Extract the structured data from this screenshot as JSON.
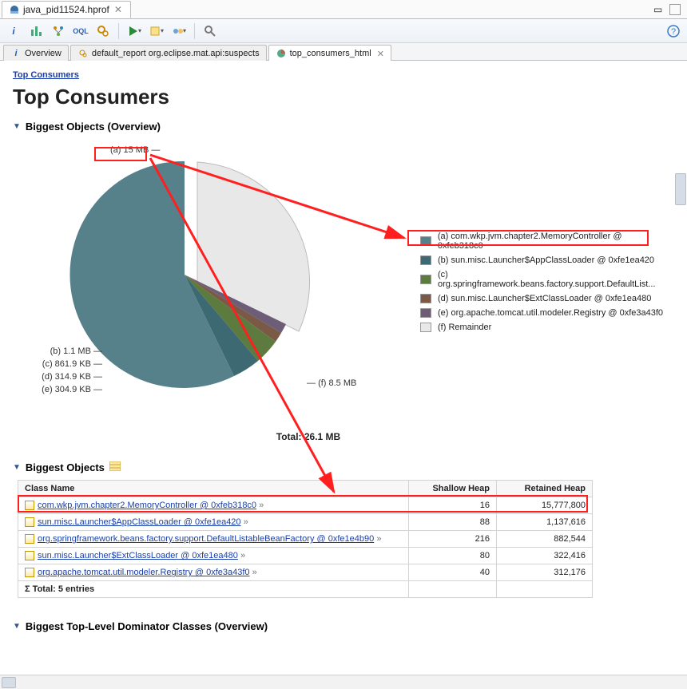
{
  "editor_tab": {
    "title": "java_pid11524.hprof"
  },
  "sub_tabs": [
    {
      "label": "Overview",
      "icon": "info"
    },
    {
      "label": "default_report  org.eclipse.mat.api:suspects",
      "icon": "report"
    },
    {
      "label": "top_consumers_html",
      "icon": "pie",
      "active": true
    }
  ],
  "breadcrumb": "Top Consumers",
  "page_title": "Top Consumers",
  "sections": {
    "s1": "Biggest Objects (Overview)",
    "s2": "Biggest Objects",
    "s3": "Biggest Top-Level Dominator Classes (Overview)"
  },
  "pie": {
    "total_label": "Total: 26.1 MB",
    "labels": {
      "a": "(a)  15 MB",
      "b": "(b)  1.1 MB",
      "c": "(c)  861.9 KB",
      "d": "(d)  314.9 KB",
      "e": "(e)  304.9 KB",
      "f": "(f)  8.5 MB"
    },
    "legend": [
      {
        "key": "a",
        "label": "(a)  com.wkp.jvm.chapter2.MemoryController @ 0xfeb318c0",
        "color": "#56818b"
      },
      {
        "key": "b",
        "label": "(b)  sun.misc.Launcher$AppClassLoader @ 0xfe1ea420",
        "color": "#3d6a72"
      },
      {
        "key": "c",
        "label": "(c)  org.springframework.beans.factory.support.DefaultList...",
        "color": "#5d7a3f"
      },
      {
        "key": "d",
        "label": "(d)  sun.misc.Launcher$ExtClassLoader @ 0xfe1ea480",
        "color": "#7a5a46"
      },
      {
        "key": "e",
        "label": "(e)  org.apache.tomcat.util.modeler.Registry @ 0xfe3a43f0",
        "color": "#6e5d77"
      },
      {
        "key": "f",
        "label": "(f)  Remainder",
        "color": "#e8e8e8"
      }
    ]
  },
  "table": {
    "headers": {
      "c1": "Class Name",
      "c2": "Shallow Heap",
      "c3": "Retained Heap"
    },
    "rows": [
      {
        "name": "com.wkp.jvm.chapter2.MemoryController @ 0xfeb318c0",
        "shallow": "16",
        "retained": "15,777,800"
      },
      {
        "name": "sun.misc.Launcher$AppClassLoader @ 0xfe1ea420",
        "shallow": "88",
        "retained": "1,137,616"
      },
      {
        "name": "org.springframework.beans.factory.support.DefaultListableBeanFactory @ 0xfe1e4b90",
        "shallow": "216",
        "retained": "882,544"
      },
      {
        "name": "sun.misc.Launcher$ExtClassLoader @ 0xfe1ea480",
        "shallow": "80",
        "retained": "322,416"
      },
      {
        "name": "org.apache.tomcat.util.modeler.Registry @ 0xfe3a43f0",
        "shallow": "40",
        "retained": "312,176"
      }
    ],
    "total_label": "Total: 5 entries"
  },
  "chart_data": {
    "type": "pie",
    "title": "Biggest Objects (Overview)",
    "total": "26.1 MB",
    "slices": [
      {
        "key": "a",
        "label": "com.wkp.jvm.chapter2.MemoryController @ 0xfeb318c0",
        "value_mb": 15.0,
        "display": "15 MB"
      },
      {
        "key": "b",
        "label": "sun.misc.Launcher$AppClassLoader @ 0xfe1ea420",
        "value_mb": 1.1,
        "display": "1.1 MB"
      },
      {
        "key": "c",
        "label": "org.springframework.beans.factory.support.DefaultListableBeanFactory",
        "value_mb": 0.842,
        "display": "861.9 KB"
      },
      {
        "key": "d",
        "label": "sun.misc.Launcher$ExtClassLoader @ 0xfe1ea480",
        "value_mb": 0.308,
        "display": "314.9 KB"
      },
      {
        "key": "e",
        "label": "org.apache.tomcat.util.modeler.Registry @ 0xfe3a43f0",
        "value_mb": 0.298,
        "display": "304.9 KB"
      },
      {
        "key": "f",
        "label": "Remainder",
        "value_mb": 8.5,
        "display": "8.5 MB"
      }
    ]
  }
}
